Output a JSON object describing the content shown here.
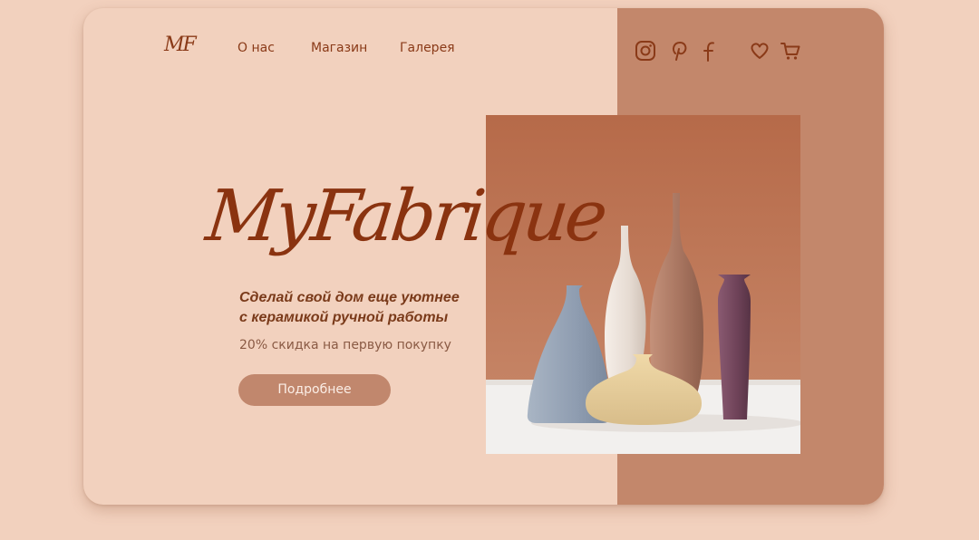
{
  "header": {
    "logo": "MF",
    "nav": [
      "О нас",
      "Магазин",
      "Галерея"
    ]
  },
  "icons": [
    "instagram-icon",
    "pinterest-icon",
    "facebook-icon",
    "heart-icon",
    "cart-icon"
  ],
  "hero": {
    "brand": "MyFabrique",
    "tagline_line1": "Сделай свой дом еще уютнее",
    "tagline_line2": "с керамикой ручной работы",
    "discount": "20% скидка на первую покупку",
    "cta_label": "Подробнее"
  },
  "colors": {
    "background": "#f2d1be",
    "panel": "#c3876b",
    "brand_text": "#8a3310",
    "button": "#c1876d"
  }
}
